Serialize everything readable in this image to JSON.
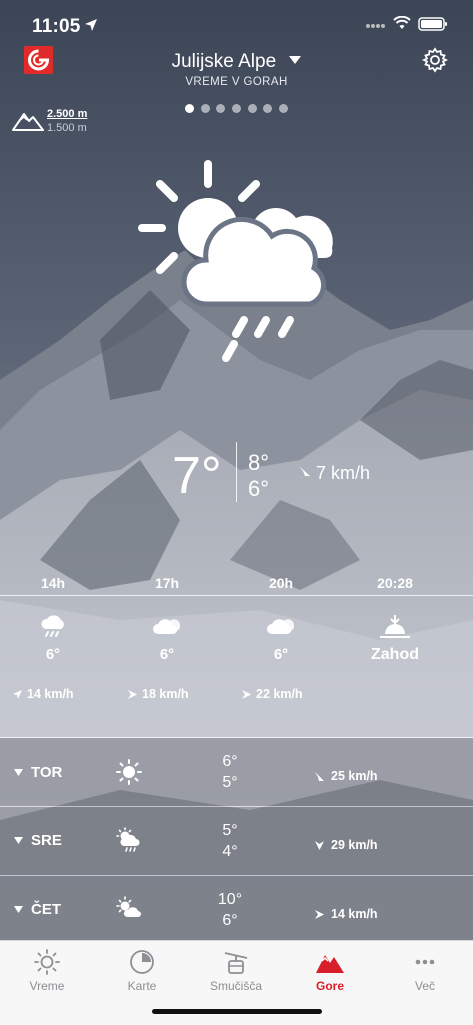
{
  "status_bar": {
    "time": "11:05"
  },
  "header": {
    "location": "Julijske Alpe",
    "subtitle": "VREME V GORAH",
    "pages": 7,
    "active_page": 0
  },
  "altitude": {
    "high": "2.500 m",
    "low": "1.500 m"
  },
  "current": {
    "icon": "sun-cloud-rain-icon",
    "temp": "7°",
    "max": "8°",
    "min": "6°",
    "wind": "7 km/h"
  },
  "hourly": [
    {
      "label": "14h",
      "icon": "cloud-rain-icon",
      "temp": "6°",
      "wind": "14 km/h"
    },
    {
      "label": "17h",
      "icon": "cloud-icon",
      "temp": "6°",
      "wind": "18 km/h"
    },
    {
      "label": "20h",
      "icon": "cloud-icon",
      "temp": "6°",
      "wind": "22 km/h"
    },
    {
      "label": "20:28",
      "icon": "sunset-icon",
      "temp": "Zahod"
    }
  ],
  "daily": [
    {
      "day": "TOR",
      "icon": "sun-icon",
      "max": "6°",
      "min": "5°",
      "wind": "25 km/h"
    },
    {
      "day": "SRE",
      "icon": "sun-cloud-rain-icon",
      "max": "5°",
      "min": "4°",
      "wind": "29 km/h"
    },
    {
      "day": "ČET",
      "icon": "sun-cloud-icon",
      "max": "10°",
      "min": "6°",
      "wind": "14 km/h"
    }
  ],
  "tabs": [
    {
      "label": "Vreme",
      "icon": "sun-icon"
    },
    {
      "label": "Karte",
      "icon": "map-icon"
    },
    {
      "label": "Smučišča",
      "icon": "cable-car-icon"
    },
    {
      "label": "Gore",
      "icon": "mountain-icon",
      "active": true
    },
    {
      "label": "Več",
      "icon": "more-icon"
    }
  ],
  "colors": {
    "accent": "#d81e2a",
    "logo": "#e12a2a",
    "tab_bg": "#f7f7f7"
  }
}
